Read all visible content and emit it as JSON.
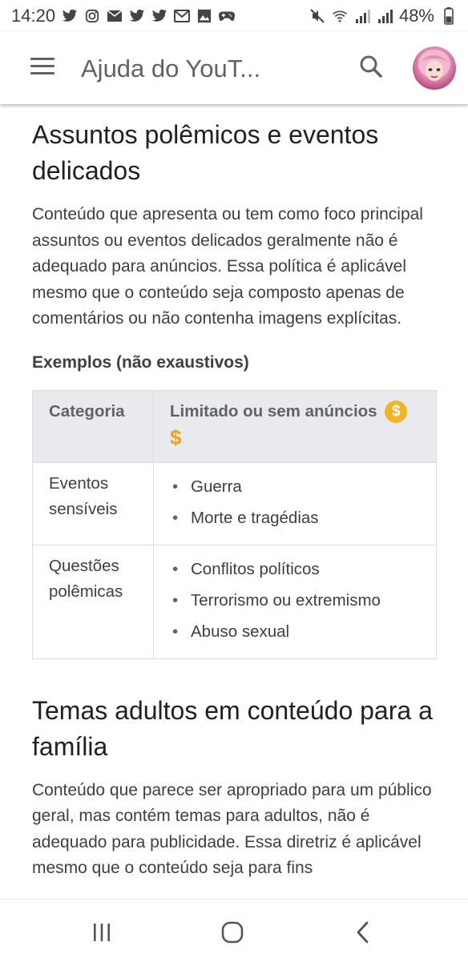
{
  "status_bar": {
    "time": "14:20",
    "battery": "48%",
    "left_icons": [
      "twitter-icon",
      "instagram-icon",
      "mail-icon",
      "twitter-icon",
      "twitter-icon",
      "gmail-icon",
      "image-icon",
      "gamepad-icon"
    ],
    "right_icons": [
      "mute-icon",
      "wifi-icon",
      "signal-icon",
      "signal-icon"
    ]
  },
  "app_bar": {
    "title": "Ajuda do YouT...",
    "menu_icon": "hamburger-menu-icon",
    "search_icon": "search-icon"
  },
  "section1": {
    "title": "Assuntos polêmicos e eventos delicados",
    "description": "Conteúdo que apresenta ou tem como foco principal assuntos ou eventos delicados geralmente não é adequado para anúncios. Essa política é aplicável mesmo que o conteúdo seja composto apenas de comentários ou não contenha imagens explícitas.",
    "examples_label": "Exemplos (não exaustivos)",
    "table": {
      "headers": [
        "Categoria",
        "Limitado ou sem anúncios"
      ],
      "rows": [
        {
          "category": "Eventos sensíveis",
          "items": [
            "Guerra",
            "Morte e tragédias"
          ]
        },
        {
          "category": "Questões polêmicas",
          "items": [
            "Conflitos políticos",
            "Terrorismo ou extremismo",
            "Abuso sexual"
          ]
        }
      ]
    },
    "coin_symbol": "$",
    "dollar_symbol": "$"
  },
  "section2": {
    "title": "Temas adultos em conteúdo para a família",
    "description": "Conteúdo que parece ser apropriado para um público geral, mas contém temas para adultos, não é adequado para publicidade. Essa diretriz é aplicável mesmo que o conteúdo seja para fins"
  },
  "nav_bar": {
    "buttons": [
      "recent-apps-icon",
      "home-icon",
      "back-icon"
    ]
  },
  "colors": {
    "accent_gold": "#f3b323",
    "text": "#202124",
    "muted": "#5f6368",
    "table_header_bg": "#e8eaed"
  }
}
